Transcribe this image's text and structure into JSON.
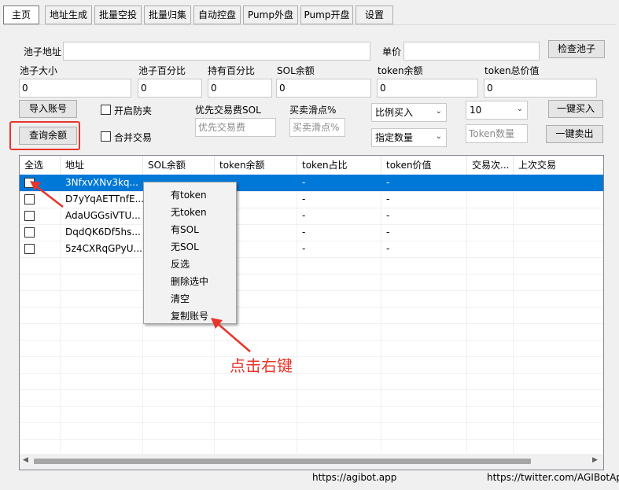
{
  "tabs": [
    {
      "label": "主页",
      "active": true
    },
    {
      "label": "地址生成"
    },
    {
      "label": "批量空投"
    },
    {
      "label": "批量归集"
    },
    {
      "label": "自动控盘"
    },
    {
      "label": "Pump外盘"
    },
    {
      "label": "Pump开盘"
    },
    {
      "label": "设置"
    }
  ],
  "form": {
    "pool_address_label": "池子地址",
    "pool_address_value": "",
    "price_label": "单价",
    "price_value": "",
    "check_pool_button": "检查池子",
    "pool_size_label": "池子大小",
    "pool_size_value": "0",
    "pool_pct_label": "池子百分比",
    "pool_pct_value": "0",
    "hold_pct_label": "持有百分比",
    "hold_pct_value": "0",
    "sol_balance_label": "SOL余额",
    "sol_balance_value": "0",
    "token_balance_label": "token余额",
    "token_balance_value": "0",
    "token_total_label": "token总价值",
    "token_total_value": "0",
    "import_button": "导入账号",
    "anti_clip_label": "开启防夹",
    "priority_fee_label": "优先交易费SOL",
    "priority_fee_placeholder": "优先交易费",
    "slippage_label": "买卖滑点%",
    "slippage_placeholder": "买卖滑点%",
    "buy_mode_value": "比例买入",
    "buy_ratio_value": "10",
    "buy_all_button": "一键买入",
    "query_balance_button": "查询余额",
    "merge_label": "合并交易",
    "sell_mode_value": "指定数量",
    "token_amount_placeholder": "Token数量",
    "sell_all_button": "一键卖出"
  },
  "table": {
    "columns": [
      "全选",
      "地址",
      "SOL余额",
      "token余额",
      "token占比",
      "token价值",
      "交易次...",
      "上次交易"
    ],
    "rows": [
      {
        "address": "3NfxvXNv3kq...",
        "sol": "",
        "token": "",
        "pct": "-",
        "value": "-",
        "selected": true
      },
      {
        "address": "D7yYqAETTnfE...",
        "sol": "",
        "token": "",
        "pct": "-",
        "value": "-"
      },
      {
        "address": "AdaUGGsiVTU...",
        "sol": "",
        "token": "",
        "pct": "-",
        "value": "-"
      },
      {
        "address": "DqdQK6Df5hs...",
        "sol": "",
        "token": "",
        "pct": "-",
        "value": "-"
      },
      {
        "address": "5z4CXRqGPyU...",
        "sol": "",
        "token": "",
        "pct": "-",
        "value": "-"
      }
    ]
  },
  "context_menu": {
    "items": [
      "有token",
      "无token",
      "有SOL",
      "无SOL",
      "反选",
      "删除选中",
      "清空",
      "复制账号"
    ]
  },
  "annotation": {
    "text": "点击右键",
    "color": "#e8352b"
  },
  "status_bar": {
    "left": "https://agibot.app",
    "right": "https://twitter.com/AGIBotAp"
  },
  "colors": {
    "selection": "#0078d7",
    "highlight_box": "#e8352b"
  }
}
